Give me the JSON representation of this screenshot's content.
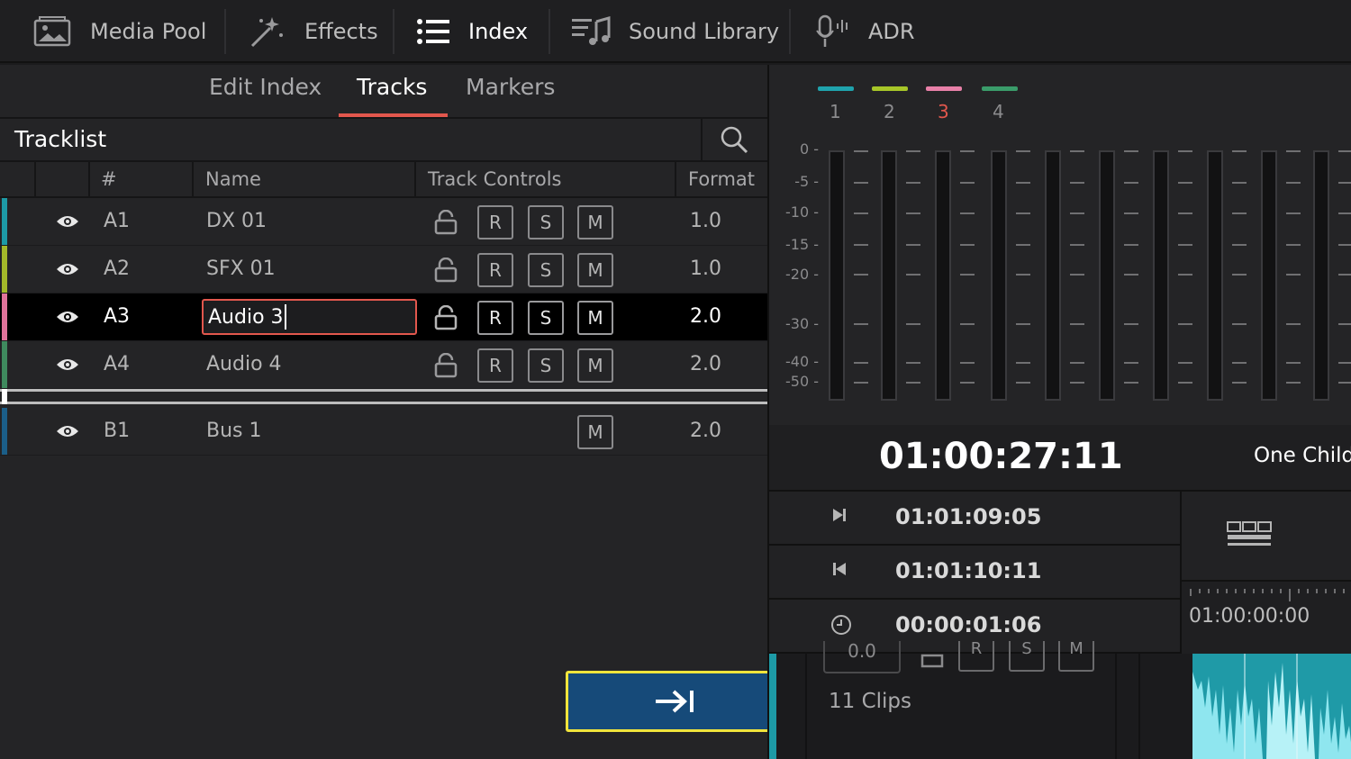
{
  "toolbar": {
    "items": [
      {
        "label": "Media Pool",
        "icon": "media-pool-icon"
      },
      {
        "label": "Effects",
        "icon": "effects-wand-icon"
      },
      {
        "label": "Index",
        "icon": "index-list-icon",
        "active": true
      },
      {
        "label": "Sound Library",
        "icon": "sound-library-icon"
      },
      {
        "label": "ADR",
        "icon": "microphone-icon"
      }
    ]
  },
  "subtabs": {
    "items": [
      "Edit Index",
      "Tracks",
      "Markers"
    ],
    "active": "Tracks"
  },
  "tracklist": {
    "title": "Tracklist",
    "columns": {
      "num": "#",
      "name": "Name",
      "controls": "Track Controls",
      "format": "Format"
    },
    "rows": [
      {
        "num": "A1",
        "name": "DX 01",
        "format": "1.0",
        "color": "#1d9aa6",
        "r": "R",
        "s": "S",
        "m": "M"
      },
      {
        "num": "A2",
        "name": "SFX 01",
        "format": "1.0",
        "color": "#a3b92a",
        "r": "R",
        "s": "S",
        "m": "M"
      },
      {
        "num": "A3",
        "name": "Audio 3",
        "format": "2.0",
        "color": "#e0739a",
        "r": "R",
        "s": "S",
        "m": "M",
        "selected": true
      },
      {
        "num": "A4",
        "name": "Audio 4",
        "format": "2.0",
        "color": "#3f8a5e",
        "r": "R",
        "s": "S",
        "m": "M"
      }
    ],
    "bus": {
      "num": "B1",
      "name": "Bus 1",
      "format": "2.0",
      "color": "#1b5e88",
      "m": "M"
    }
  },
  "meters": {
    "channels": [
      {
        "label": "1",
        "color": "#1fa3ad"
      },
      {
        "label": "2",
        "color": "#a7c628"
      },
      {
        "label": "3",
        "color": "#e880a8",
        "active": true
      },
      {
        "label": "4",
        "color": "#3a9c6a"
      }
    ],
    "scale": [
      "0 -",
      "-5 -",
      "-10 -",
      "-15 -",
      "-20 -",
      "-30 -",
      "-40 -",
      "-50 -"
    ],
    "active_color": "#e2574d"
  },
  "timecode": {
    "current": "01:00:27:11",
    "title": "One Child",
    "in": "01:01:09:05",
    "out": "01:01:10:11",
    "duration": "00:00:01:06",
    "ruler": "01:00:00:00"
  },
  "timeline": {
    "clips": "11 Clips",
    "partial_value": "0.0",
    "partial_buttons": [
      "R",
      "S",
      "M"
    ]
  }
}
